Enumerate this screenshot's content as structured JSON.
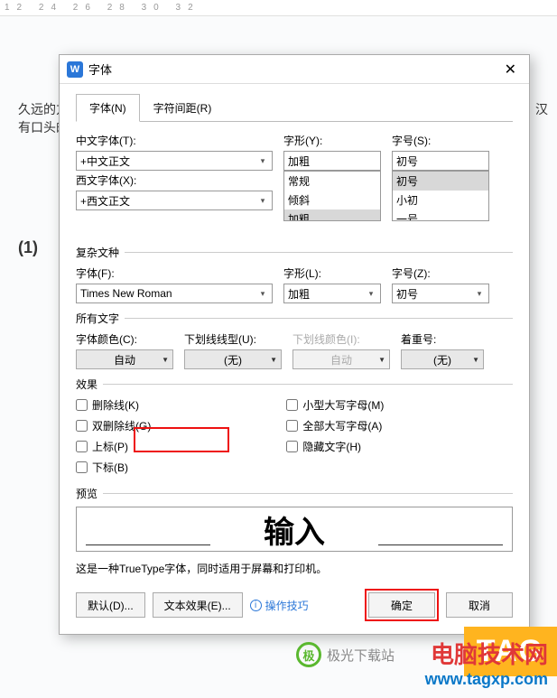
{
  "ruler": "12  24  26  28  30  32",
  "bg_doc_line1": "久远的方",
  "bg_doc_line2": "有口头的语",
  "bg_doc_right1": "字，汉",
  "bg_doc_num": "(1)",
  "dialog": {
    "title": "字体",
    "tabs": {
      "font": "字体(N)",
      "spacing": "字符间距(R)"
    },
    "cn_font_label": "中文字体(T):",
    "cn_font_value": "+中文正文",
    "style_label": "字形(Y):",
    "style_value": "加粗",
    "style_list": [
      "常规",
      "倾斜",
      "加粗"
    ],
    "size_label": "字号(S):",
    "size_value": "初号",
    "size_list": [
      "初号",
      "小初",
      "一号"
    ],
    "en_font_label": "西文字体(X):",
    "en_font_value": "+西文正文",
    "complex_section": "复杂文种",
    "cx_font_label": "字体(F):",
    "cx_font_value": "Times New Roman",
    "cx_style_label": "字形(L):",
    "cx_style_value": "加粗",
    "cx_size_label": "字号(Z):",
    "cx_size_value": "初号",
    "alltext_section": "所有文字",
    "color_label": "字体颜色(C):",
    "color_value": "自动",
    "uline_label": "下划线线型(U):",
    "uline_value": "(无)",
    "ulinec_label": "下划线颜色(I):",
    "ulinec_value": "自动",
    "emph_label": "着重号:",
    "emph_value": "(无)",
    "fx_section": "效果",
    "fx_strike": "删除线(K)",
    "fx_dstrike": "双删除线(G)",
    "fx_super": "上标(P)",
    "fx_sub": "下标(B)",
    "fx_smallcaps": "小型大写字母(M)",
    "fx_allcaps": "全部大写字母(A)",
    "fx_hidden": "隐藏文字(H)",
    "preview_label": "预览",
    "preview_text": "输入",
    "desc": "这是一种TrueType字体，同时适用于屏幕和打印机。",
    "btn_default": "默认(D)...",
    "btn_textfx": "文本效果(E)...",
    "link_tips": "操作技巧",
    "btn_ok": "确定",
    "btn_cancel": "取消"
  },
  "watermark_cn": "电脑技术网",
  "watermark_url": "www.tagxp.com",
  "tag_badge": "TAG",
  "jk_text": "极光下载站"
}
